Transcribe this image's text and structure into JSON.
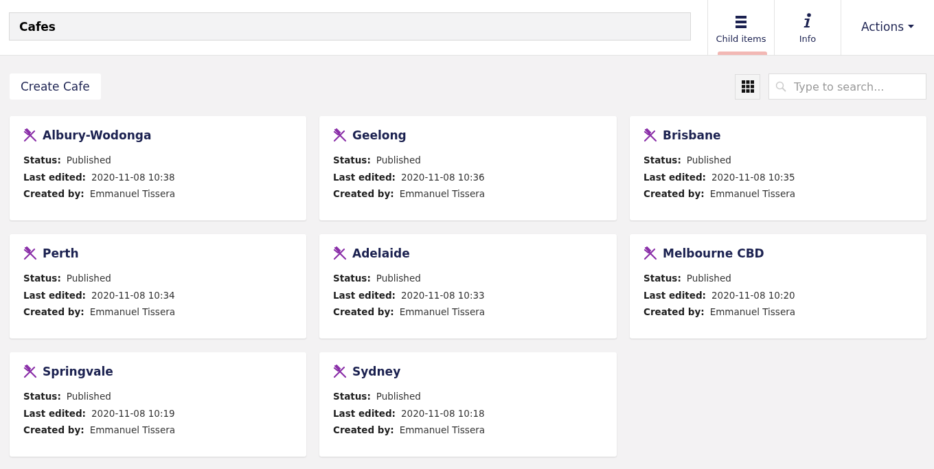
{
  "header": {
    "name": "Cafes",
    "tabs": [
      {
        "label": "Child items",
        "kind": "list",
        "selected": true
      },
      {
        "label": "Info",
        "kind": "info",
        "selected": false
      }
    ],
    "actions": "Actions"
  },
  "toolbar": {
    "create": "Create Cafe",
    "search": {
      "placeholder": "Type to search..."
    }
  },
  "cards": [
    {
      "title": "Albury-Wodonga",
      "fields": [
        {
          "label": "Status:",
          "value": "Published"
        },
        {
          "label": "Last edited:",
          "value": "2020-11-08 10:38"
        },
        {
          "label": "Created by:",
          "value": "Emmanuel Tissera"
        }
      ]
    },
    {
      "title": "Geelong",
      "fields": [
        {
          "label": "Status:",
          "value": "Published"
        },
        {
          "label": "Last edited:",
          "value": "2020-11-08 10:36"
        },
        {
          "label": "Created by:",
          "value": "Emmanuel Tissera"
        }
      ]
    },
    {
      "title": "Brisbane",
      "fields": [
        {
          "label": "Status:",
          "value": "Published"
        },
        {
          "label": "Last edited:",
          "value": "2020-11-08 10:35"
        },
        {
          "label": "Created by:",
          "value": "Emmanuel Tissera"
        }
      ]
    },
    {
      "title": "Perth",
      "fields": [
        {
          "label": "Status:",
          "value": "Published"
        },
        {
          "label": "Last edited:",
          "value": "2020-11-08 10:34"
        },
        {
          "label": "Created by:",
          "value": "Emmanuel Tissera"
        }
      ]
    },
    {
      "title": "Adelaide",
      "fields": [
        {
          "label": "Status:",
          "value": "Published"
        },
        {
          "label": "Last edited:",
          "value": "2020-11-08 10:33"
        },
        {
          "label": "Created by:",
          "value": "Emmanuel Tissera"
        }
      ]
    },
    {
      "title": "Melbourne CBD",
      "fields": [
        {
          "label": "Status:",
          "value": "Published"
        },
        {
          "label": "Last edited:",
          "value": "2020-11-08 10:20"
        },
        {
          "label": "Created by:",
          "value": "Emmanuel Tissera"
        }
      ]
    },
    {
      "title": "Springvale",
      "fields": [
        {
          "label": "Status:",
          "value": "Published"
        },
        {
          "label": "Last edited:",
          "value": "2020-11-08 10:19"
        },
        {
          "label": "Created by:",
          "value": "Emmanuel Tissera"
        }
      ]
    },
    {
      "title": "Sydney",
      "fields": [
        {
          "label": "Status:",
          "value": "Published"
        },
        {
          "label": "Last edited:",
          "value": "2020-11-08 10:18"
        },
        {
          "label": "Created by:",
          "value": "Emmanuel Tissera"
        }
      ]
    }
  ]
}
